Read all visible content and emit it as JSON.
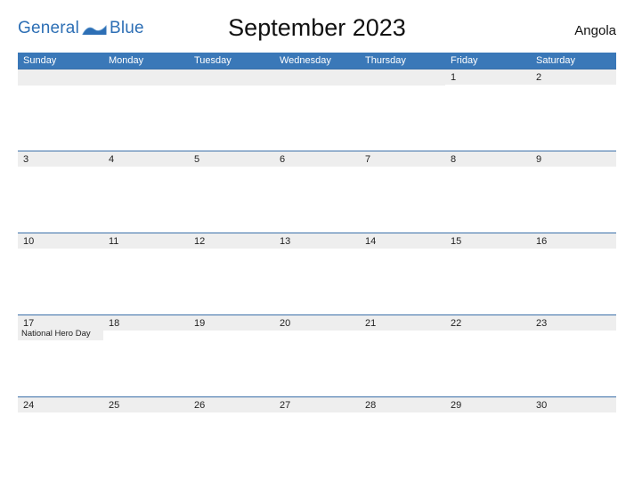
{
  "logo": {
    "text1": "General",
    "text2": "Blue"
  },
  "title": "September 2023",
  "country": "Angola",
  "daynames": [
    "Sunday",
    "Monday",
    "Tuesday",
    "Wednesday",
    "Thursday",
    "Friday",
    "Saturday"
  ],
  "weeks": [
    [
      {
        "n": "",
        "h": ""
      },
      {
        "n": "",
        "h": ""
      },
      {
        "n": "",
        "h": ""
      },
      {
        "n": "",
        "h": ""
      },
      {
        "n": "",
        "h": ""
      },
      {
        "n": "1",
        "h": ""
      },
      {
        "n": "2",
        "h": ""
      }
    ],
    [
      {
        "n": "3",
        "h": ""
      },
      {
        "n": "4",
        "h": ""
      },
      {
        "n": "5",
        "h": ""
      },
      {
        "n": "6",
        "h": ""
      },
      {
        "n": "7",
        "h": ""
      },
      {
        "n": "8",
        "h": ""
      },
      {
        "n": "9",
        "h": ""
      }
    ],
    [
      {
        "n": "10",
        "h": ""
      },
      {
        "n": "11",
        "h": ""
      },
      {
        "n": "12",
        "h": ""
      },
      {
        "n": "13",
        "h": ""
      },
      {
        "n": "14",
        "h": ""
      },
      {
        "n": "15",
        "h": ""
      },
      {
        "n": "16",
        "h": ""
      }
    ],
    [
      {
        "n": "17",
        "h": "National Hero Day"
      },
      {
        "n": "18",
        "h": ""
      },
      {
        "n": "19",
        "h": ""
      },
      {
        "n": "20",
        "h": ""
      },
      {
        "n": "21",
        "h": ""
      },
      {
        "n": "22",
        "h": ""
      },
      {
        "n": "23",
        "h": ""
      }
    ],
    [
      {
        "n": "24",
        "h": ""
      },
      {
        "n": "25",
        "h": ""
      },
      {
        "n": "26",
        "h": ""
      },
      {
        "n": "27",
        "h": ""
      },
      {
        "n": "28",
        "h": ""
      },
      {
        "n": "29",
        "h": ""
      },
      {
        "n": "30",
        "h": ""
      }
    ]
  ]
}
